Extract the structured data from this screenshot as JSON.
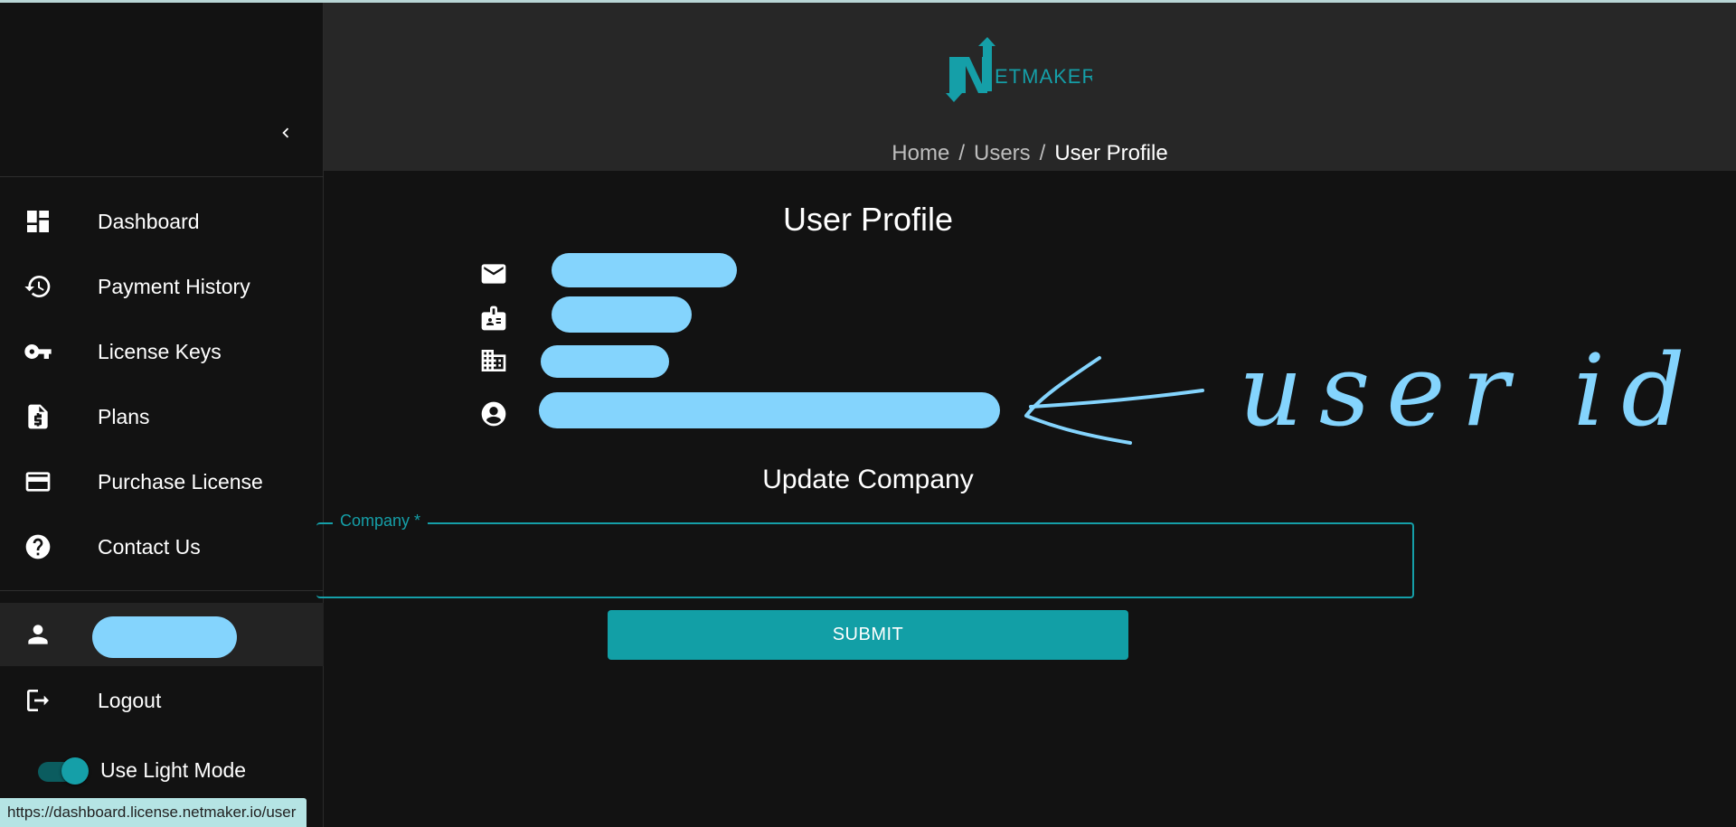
{
  "sidebar": {
    "items": [
      {
        "label": "Dashboard",
        "icon": "dashboard-icon"
      },
      {
        "label": "Payment History",
        "icon": "history-icon"
      },
      {
        "label": "License Keys",
        "icon": "key-icon"
      },
      {
        "label": "Plans",
        "icon": "dollar-document-icon"
      },
      {
        "label": "Purchase License",
        "icon": "credit-card-icon"
      },
      {
        "label": "Contact Us",
        "icon": "help-circle-icon"
      }
    ],
    "user_icon": "person-icon",
    "logout_label": "Logout",
    "light_mode_label": "Use Light Mode",
    "light_mode_on": true
  },
  "status_bar_url": "https://dashboard.license.netmaker.io/user",
  "header": {
    "logo_text": "ETMAKER",
    "logo_letter": "N",
    "breadcrumb": {
      "home": "Home",
      "users": "Users",
      "current": "User Profile",
      "separator": "/"
    }
  },
  "main": {
    "title": "User Profile",
    "info_icons": [
      "email-icon",
      "id-badge-icon",
      "building-icon",
      "account-circle-icon"
    ],
    "update_title": "Update Company",
    "company_label": "Company *",
    "company_value": "",
    "submit_label": "SUBMIT"
  },
  "annotation_text": "user id",
  "colors": {
    "accent": "#159fa8",
    "background": "#121212",
    "header_bg": "#272727",
    "redaction": "#84d4fd"
  }
}
